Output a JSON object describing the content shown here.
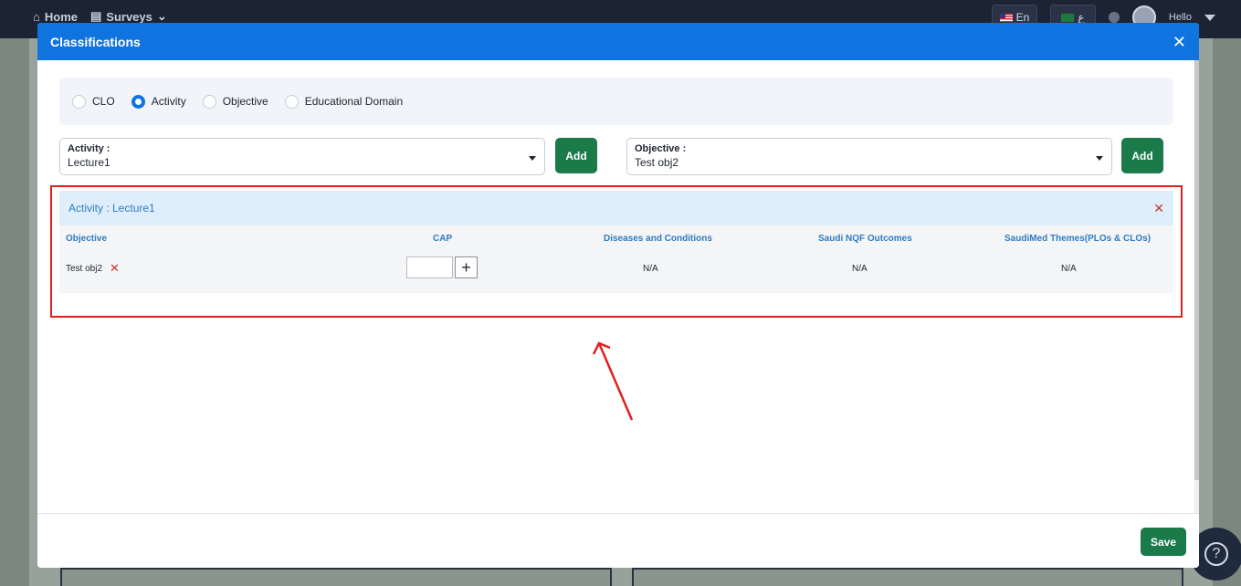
{
  "nav": {
    "home": "Home",
    "surveys": "Surveys"
  },
  "header_right": {
    "lang_en": "En",
    "lang_ar": "ع",
    "hello": "Hello"
  },
  "modal": {
    "title": "Classifications",
    "radios": [
      {
        "label": "CLO",
        "checked": false
      },
      {
        "label": "Activity",
        "checked": true
      },
      {
        "label": "Objective",
        "checked": false
      },
      {
        "label": "Educational Domain",
        "checked": false
      }
    ],
    "activity_select": {
      "label": "Activity :",
      "value": "Lecture1"
    },
    "objective_select": {
      "label": "Objective :",
      "value": "Test obj2"
    },
    "add_label": "Add",
    "card": {
      "title": "Activity : Lecture1",
      "columns": [
        "Objective",
        "CAP",
        "Diseases and Conditions",
        "Saudi NQF Outcomes",
        "SaudiMed Themes(PLOs & CLOs)"
      ],
      "row": {
        "objective": "Test obj2",
        "diseases": "N/A",
        "nqf": "N/A",
        "themes": "N/A"
      }
    },
    "save_label": "Save"
  },
  "colors": {
    "accent": "#1074e0",
    "success": "#1b7a4a",
    "highlight": "#e02020"
  }
}
